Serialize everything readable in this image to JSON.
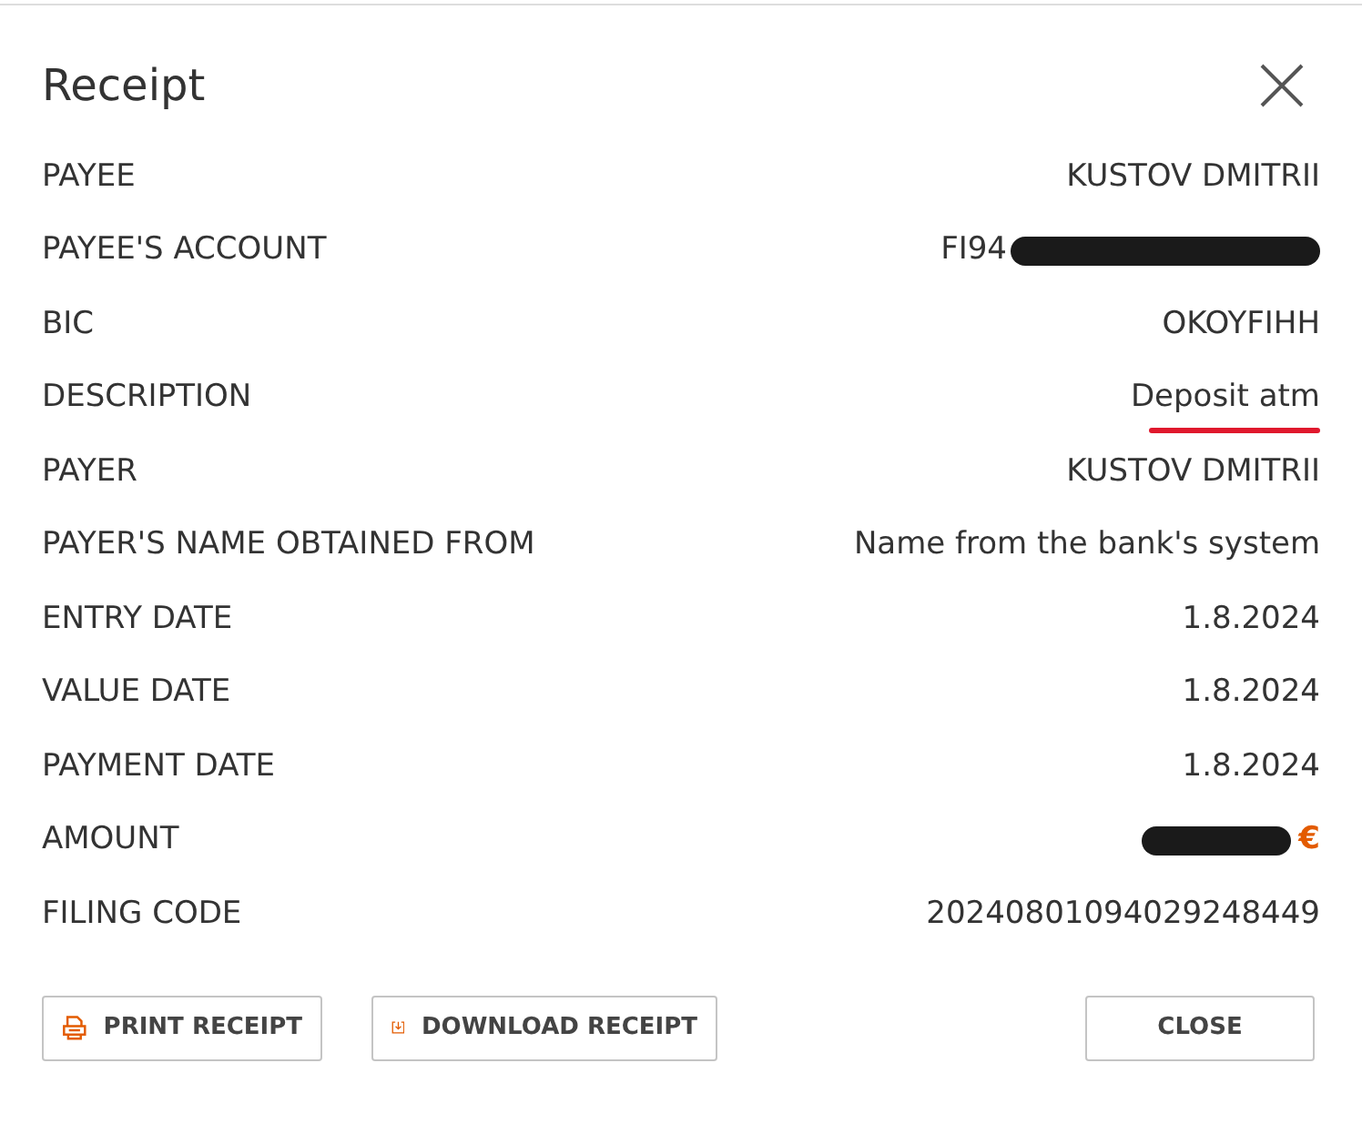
{
  "dialog": {
    "title": "Receipt"
  },
  "rows": [
    {
      "label": "PAYEE",
      "kind": "text",
      "value": "KUSTOV DMITRII"
    },
    {
      "label": "PAYEE'S ACCOUNT",
      "kind": "redacted",
      "value": "FI94"
    },
    {
      "label": "BIC",
      "kind": "text",
      "value": "OKOYFIHH"
    },
    {
      "label": "DESCRIPTION",
      "kind": "underlined",
      "value": "Deposit atm"
    },
    {
      "label": "PAYER",
      "kind": "text",
      "value": "KUSTOV DMITRII"
    },
    {
      "label": "PAYER'S NAME OBTAINED FROM",
      "kind": "text",
      "value": "Name from the bank's system"
    },
    {
      "label": "ENTRY DATE",
      "kind": "text",
      "value": "1.8.2024"
    },
    {
      "label": "VALUE DATE",
      "kind": "text",
      "value": "1.8.2024"
    },
    {
      "label": "PAYMENT DATE",
      "kind": "text",
      "value": "1.8.2024"
    },
    {
      "label": "AMOUNT",
      "kind": "amount",
      "value": "€"
    },
    {
      "label": "FILING CODE",
      "kind": "text",
      "value": "20240801094029248449"
    }
  ],
  "buttons": [
    {
      "label": "PRINT RECEIPT",
      "kind": "print"
    },
    {
      "label": "DOWNLOAD RECEIPT",
      "kind": "download"
    },
    {
      "label": "CLOSE",
      "kind": "close"
    }
  ]
}
